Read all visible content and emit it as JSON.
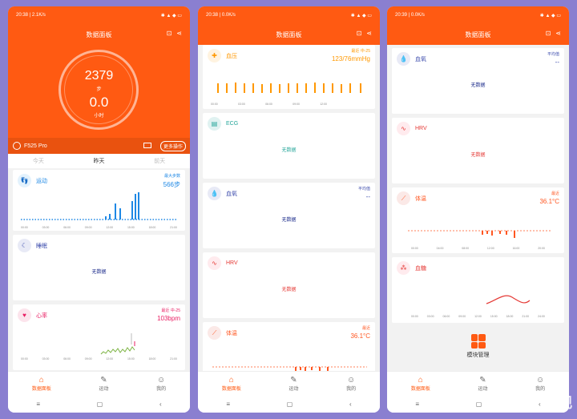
{
  "status": {
    "p1_time": "20:38 | 2.1K/s",
    "p2_time": "20:38 | 0.0K/s",
    "p3_time": "20:39 | 0.0K/s",
    "right": "✱ ▲ ◆ ▭"
  },
  "title": "数据面板",
  "hero": {
    "steps": "2379",
    "steps_unit": "步",
    "hours": "0.0",
    "hours_unit": "小时"
  },
  "device": {
    "name": "F525 Pro",
    "more": "更多操作"
  },
  "days": [
    "今天",
    "昨天",
    "前天"
  ],
  "cards": {
    "sport": {
      "title": "运动",
      "right_label": "最大步数",
      "right_value": "566步"
    },
    "sleep": {
      "title": "睡眠",
      "nodata": "无数据"
    },
    "heart": {
      "title": "心率",
      "right_label": "最近 中-25",
      "right_value": "103bpm"
    },
    "bp": {
      "title": "血压",
      "right_label": "最近 中-25",
      "right_value": "123/76mmHg"
    },
    "ecg": {
      "title": "ECG",
      "nodata": "无数据"
    },
    "spo2": {
      "title": "血氧",
      "right_label": "平均值",
      "right_value": "--",
      "nodata": "无数据"
    },
    "hrv": {
      "title": "HRV",
      "nodata": "无数据"
    },
    "temp": {
      "title": "体温",
      "right_label": "最近",
      "right_value": "36.1°C"
    },
    "glucose": {
      "title": "血糖"
    }
  },
  "x_ticks_p1": [
    "00:00",
    "03:00",
    "06:00",
    "09:00",
    "12:00",
    "15:00",
    "18:00",
    "21:00"
  ],
  "x_ticks_bp": [
    "00:00",
    "03:00",
    "06:00",
    "09:00",
    "12:00"
  ],
  "x_ticks_temp": [
    "00:00",
    "04:00",
    "08:00",
    "12:00",
    "16:00",
    "20:00"
  ],
  "x_ticks_glucose": [
    "00:00",
    "03:00",
    "06:00",
    "09:00",
    "12:00",
    "15:00",
    "18:00",
    "21:00",
    "24:00"
  ],
  "module": {
    "label": "模块管理"
  },
  "tabs": [
    "数据面板",
    "运动",
    "我的"
  ],
  "nav": [
    "≡",
    "▢",
    "‹"
  ],
  "watermark": "新 众观",
  "colors": {
    "accent": "#ff5a12",
    "sport": "#1e88e5",
    "heart": "#e91e63",
    "bp": "#ff9800",
    "ecg": "#26a69a",
    "spo2": "#3949ab",
    "hrv": "#e53935",
    "temp": "#ff5722",
    "glucose": "#e53935"
  }
}
